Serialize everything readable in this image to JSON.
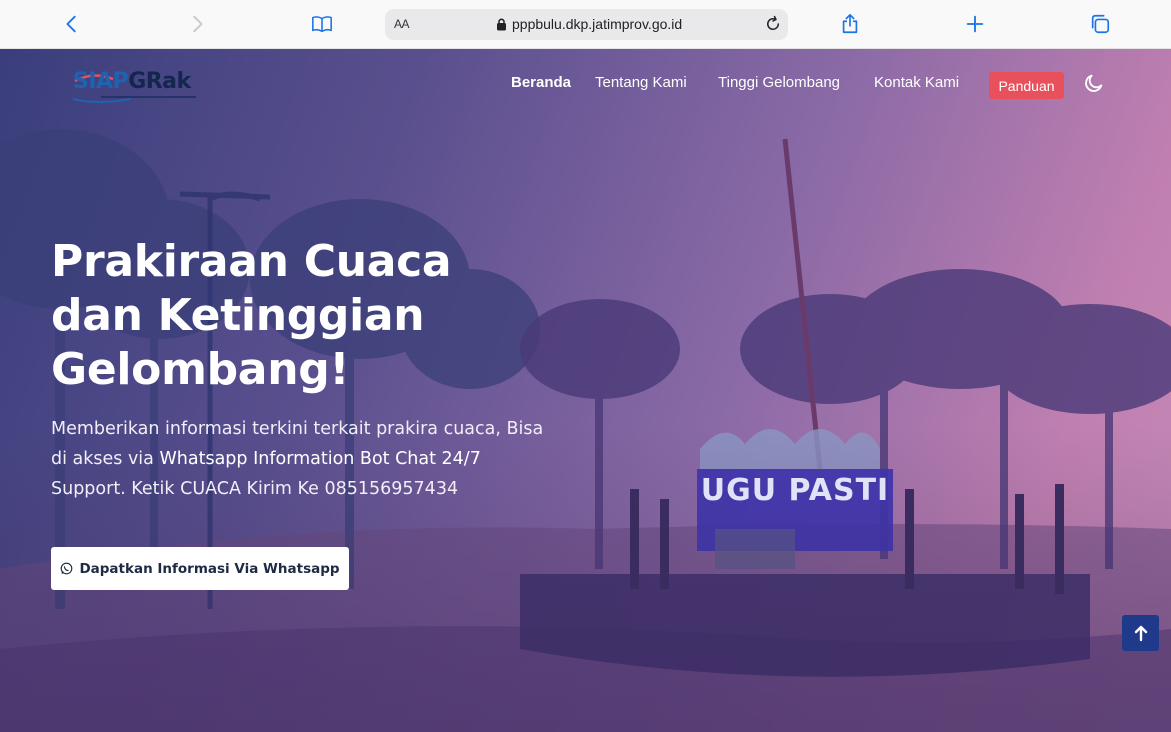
{
  "browser": {
    "aa_label": "AA",
    "url": "pppbulu.dkp.jatimprov.go.id"
  },
  "brand": {
    "logo_text_a": "SIAP",
    "logo_text_b": "GRak"
  },
  "nav": {
    "items": [
      "Beranda",
      "Tentang Kami",
      "Tinggi Gelombang",
      "Kontak Kami"
    ],
    "active": "Beranda",
    "panduan_label": "Panduan"
  },
  "hero": {
    "title": "Prakiraan Cuaca dan Ketinggian Gelombang!",
    "subtitle_plain": "Memberikan informasi terkini terkait prakira cuaca, Bisa di akses via ",
    "subtitle_highlight": "Whatsapp Information Bot Chat 24/7",
    "subtitle_end": " Support. Ketik CUACA Kirim Ke 085156957434",
    "cta_label": "Dapatkan Informasi Via Whatsapp",
    "sign_text": "UGU PASTI"
  },
  "colors": {
    "accent": "#e8505b",
    "back_to_top": "#1f3a8a"
  }
}
